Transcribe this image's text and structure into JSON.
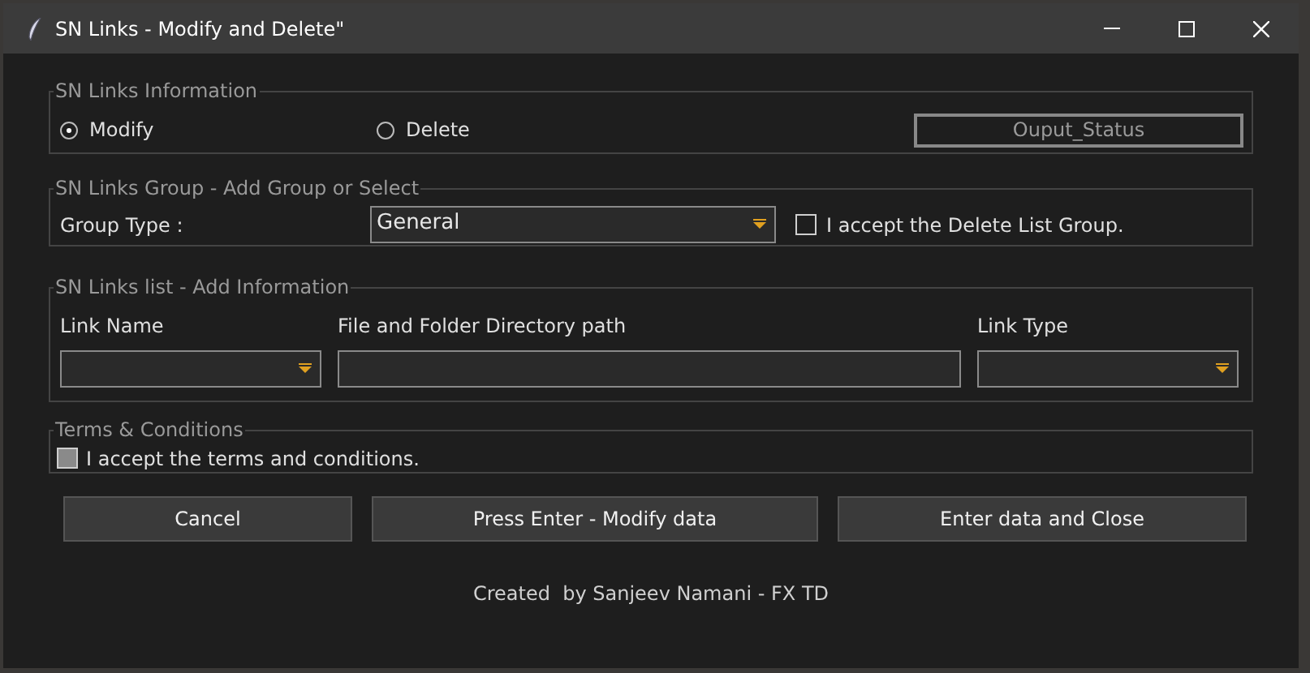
{
  "window": {
    "title": "SN Links - Modify and Delete\""
  },
  "info": {
    "legend": "SN Links Information",
    "options": [
      {
        "label": "Modify",
        "selected": true
      },
      {
        "label": "Delete",
        "selected": false
      }
    ],
    "status": "Ouput_Status"
  },
  "group": {
    "legend": "SN Links Group - Add Group or Select",
    "label": "Group Type :",
    "value": "General",
    "delete_check": {
      "label": "I accept the Delete List Group.",
      "checked": false
    }
  },
  "list": {
    "legend": "SN Links list - Add Information",
    "columns": [
      "Link Name",
      "File and Folder Directory path",
      "Link Type"
    ]
  },
  "terms": {
    "legend": "Terms & Conditions",
    "check": {
      "label": "I accept the terms and conditions.",
      "checked": true
    }
  },
  "buttons": [
    "Cancel",
    "Press Enter - Modify data",
    "Enter data and Close"
  ],
  "footer": "Created  by Sanjeev Namani - FX TD"
}
